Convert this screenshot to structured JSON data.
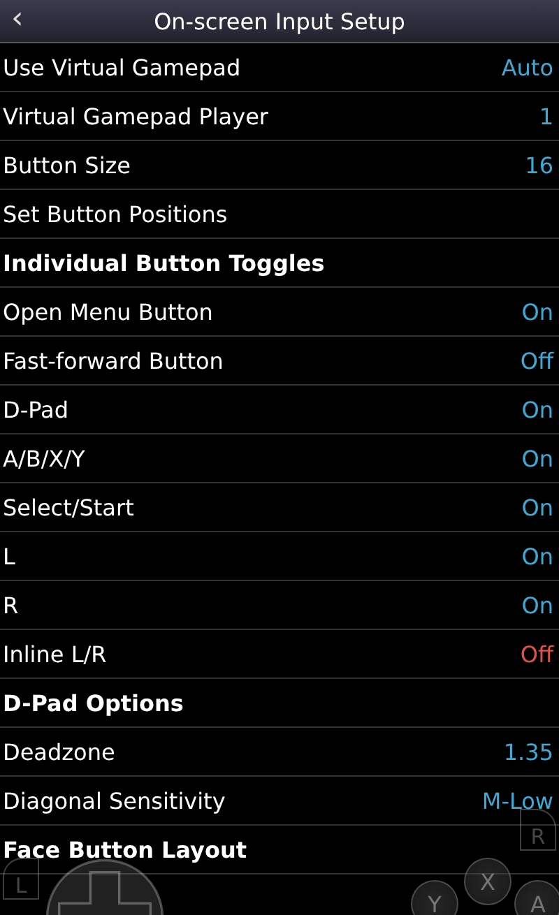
{
  "title_bar": {
    "back_icon": "‹",
    "title": "On-screen Input Setup"
  },
  "items": [
    {
      "kind": "setting",
      "label": "Use Virtual Gamepad",
      "value": "Auto",
      "color": "#3fa9d6"
    },
    {
      "kind": "setting",
      "label": "Virtual Gamepad Player",
      "value": "1",
      "color": "#3fa9d6"
    },
    {
      "kind": "setting",
      "label": "Button Size",
      "value": "16",
      "color": "#3fa9d6"
    },
    {
      "kind": "setting",
      "label": "Set Button Positions"
    },
    {
      "kind": "header",
      "label": "Individual Button Toggles"
    },
    {
      "kind": "setting",
      "label": "Open Menu Button",
      "value": "On",
      "color": "#3fa9d6"
    },
    {
      "kind": "setting",
      "label": "Fast-forward Button",
      "value": "Off",
      "color": "#3fa9d6"
    },
    {
      "kind": "setting",
      "label": "D-Pad",
      "value": "On",
      "color": "#3fa9d6"
    },
    {
      "kind": "setting",
      "label": "A/B/X/Y",
      "value": "On",
      "color": "#3fa9d6"
    },
    {
      "kind": "setting",
      "label": "Select/Start",
      "value": "On",
      "color": "#3fa9d6"
    },
    {
      "kind": "setting",
      "label": "L",
      "value": "On",
      "color": "#3fa9d6"
    },
    {
      "kind": "setting",
      "label": "R",
      "value": "On",
      "color": "#3fa9d6"
    },
    {
      "kind": "setting",
      "label": "Inline L/R",
      "value": "Off",
      "color": "#e0504a"
    },
    {
      "kind": "header",
      "label": "D-Pad Options"
    },
    {
      "kind": "setting",
      "label": "Deadzone",
      "value": "1.35",
      "color": "#3fa9d6"
    },
    {
      "kind": "setting",
      "label": "Diagonal Sensitivity",
      "value": "M-Low",
      "color": "#3fa9d6"
    },
    {
      "kind": "header",
      "label": "Face Button Layout"
    }
  ],
  "gamepad_overlay": [
    {
      "kind": "shoulder",
      "label": "R"
    },
    {
      "kind": "shoulder",
      "label": "L"
    },
    {
      "kind": "face",
      "label": "X"
    },
    {
      "kind": "face",
      "label": "Y"
    },
    {
      "kind": "face",
      "label": "A"
    },
    {
      "kind": "dpad"
    }
  ]
}
